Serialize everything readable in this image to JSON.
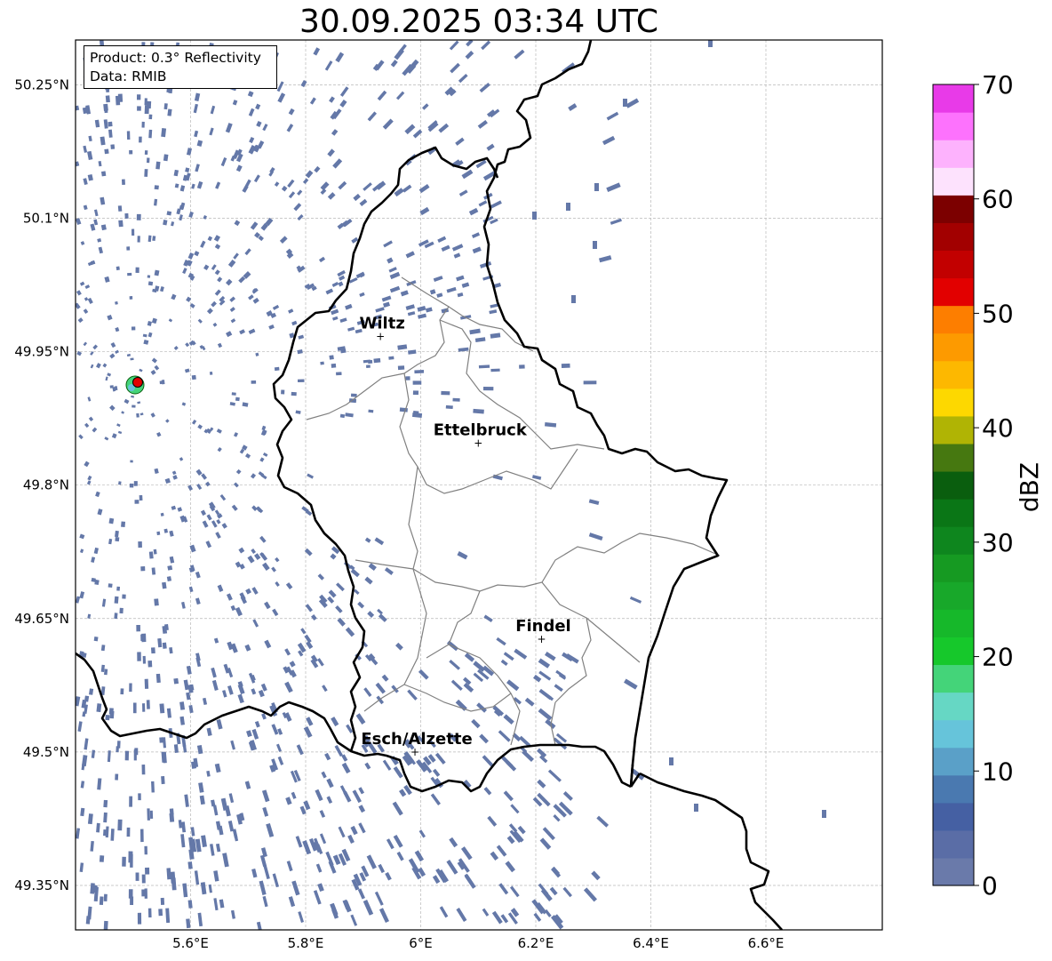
{
  "title": "30.09.2025 03:34 UTC",
  "info": {
    "product": "Product: 0.3° Reflectivity",
    "data": "Data: RMIB"
  },
  "map": {
    "lon_range": [
      5.4,
      6.8
    ],
    "lat_range": [
      49.3,
      50.3
    ],
    "lon_ticks": [
      {
        "value": 5.6,
        "label": "5.6°E"
      },
      {
        "value": 5.8,
        "label": "5.8°E"
      },
      {
        "value": 6.0,
        "label": "6°E"
      },
      {
        "value": 6.2,
        "label": "6.2°E"
      },
      {
        "value": 6.4,
        "label": "6.4°E"
      },
      {
        "value": 6.6,
        "label": "6.6°E"
      }
    ],
    "lat_ticks": [
      {
        "value": 50.25,
        "label": "50.25°N"
      },
      {
        "value": 50.1,
        "label": "50.1°N"
      },
      {
        "value": 49.95,
        "label": "49.95°N"
      },
      {
        "value": 49.8,
        "label": "49.8°N"
      },
      {
        "value": 49.65,
        "label": "49.65°N"
      },
      {
        "value": 49.5,
        "label": "49.5°N"
      },
      {
        "value": 49.35,
        "label": "49.35°N"
      }
    ],
    "cities": [
      {
        "name": "Wiltz",
        "lon": 5.93,
        "lat": 49.967
      },
      {
        "name": "Ettelbruck",
        "lon": 6.1,
        "lat": 49.847
      },
      {
        "name": "Findel",
        "lon": 6.21,
        "lat": 49.627
      },
      {
        "name": "Esch/Alzette",
        "lon": 5.99,
        "lat": 49.5
      }
    ],
    "radar_site": {
      "lon": 5.505,
      "lat": 49.915
    },
    "echo_color": "#6478a8"
  },
  "colorbar": {
    "label": "dBZ",
    "min": 0,
    "max": 70,
    "step": 2.5,
    "ticks": [
      "0",
      "10",
      "20",
      "30",
      "40",
      "50",
      "60",
      "70"
    ],
    "colors": [
      "#6a7aaa",
      "#5a6da6",
      "#4560a3",
      "#4a79b0",
      "#5aa0c8",
      "#66c4da",
      "#66d7c4",
      "#44d479",
      "#16c82b",
      "#16b82a",
      "#18a82a",
      "#169a22",
      "#0e861e",
      "#0a7616",
      "#0a5e0e",
      "#467810",
      "#b0b404",
      "#fdd800",
      "#fdb800",
      "#fd9a00",
      "#fd7e00",
      "#e20000",
      "#c20000",
      "#a20000",
      "#7c0000",
      "#fde2fd",
      "#fdb2fd",
      "#fd72fd",
      "#e83ae8"
    ]
  }
}
